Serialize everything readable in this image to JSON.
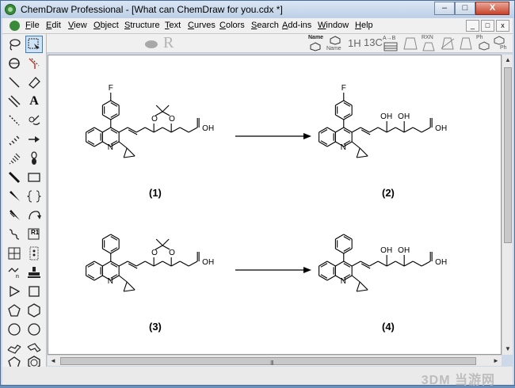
{
  "window": {
    "title": "ChemDraw Professional - [What can ChemDraw for you.cdx *]",
    "min_label": "–",
    "max_label": "□",
    "close_label": "X"
  },
  "menubar": {
    "items": [
      "File",
      "Edit",
      "View",
      "Object",
      "Structure",
      "Text",
      "Curves",
      "Colors",
      "Search",
      "Add-ins",
      "Window",
      "Help"
    ],
    "mdi": [
      "_",
      "□",
      "x"
    ]
  },
  "toolbar": {
    "r_glyph": "R",
    "name_label": "Name",
    "nmr_1h_label": "1H",
    "nmr_13c_label": "13C",
    "ab_label": "A→B",
    "rxn_label": "RXN",
    "ph_label": "Ph",
    "name2_label": "Name",
    "ph2_label": "Ph"
  },
  "palette": {
    "text_tool_glyph": "A",
    "r1_label": "R1"
  },
  "canvas": {
    "molecules": [
      {
        "id": "1",
        "substituent": "F",
        "acid": "OH",
        "kind": "acetonide"
      },
      {
        "id": "2",
        "substituent": "F",
        "acid": "OH",
        "kind": "diol",
        "oh_a": "OH",
        "oh_b": "OH"
      },
      {
        "id": "3",
        "substituent": "",
        "acid": "OH",
        "kind": "acetonide"
      },
      {
        "id": "4",
        "substituent": "",
        "acid": "OH",
        "kind": "diol",
        "oh_a": "OH",
        "oh_b": "OH"
      }
    ],
    "labels": [
      "(1)",
      "(2)",
      "(3)",
      "(4)"
    ],
    "ring_n": "N",
    "ring_o": "O"
  },
  "scroll": {
    "grip": "III"
  },
  "statusbar": {
    "watermark": "3DM 当游网"
  }
}
